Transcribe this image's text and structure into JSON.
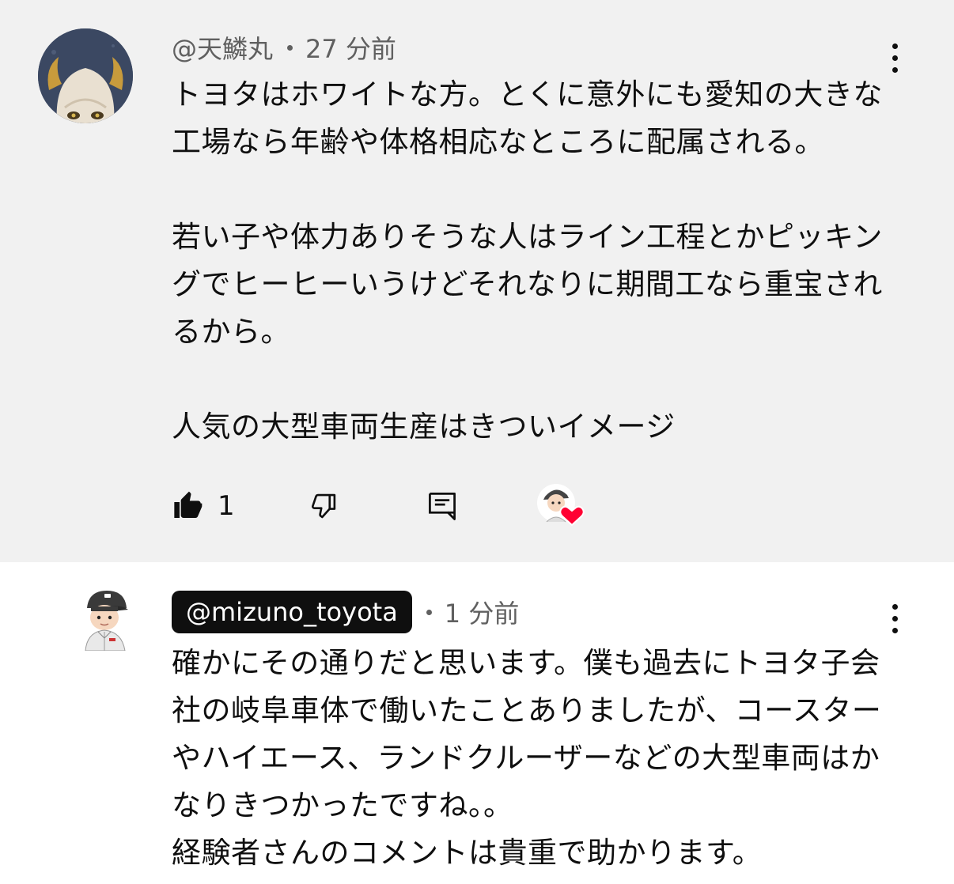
{
  "comments": [
    {
      "handle": "@天鱗丸",
      "time": "27 分前",
      "text": "トヨタはホワイトな方。とくに意外にも愛知の大きな工場なら年齢や体格相応なところに配属される。\n\n若い子や体力ありそうな人はライン工程とかピッキングでヒーヒーいうけどそれなりに期間工なら重宝されるから。\n\n人気の大型車両生産はきついイメージ",
      "like_count": "1",
      "avatar_icon": "oni-mask-avatar-icon",
      "creator_heart_icon": "creator-heart-icon"
    },
    {
      "handle": "@mizuno_toyota",
      "time": "1 分前",
      "text": "確かにその通りだと思います。僕も過去にトヨタ子会社の岐阜車体で働いたことありましたが、コースターやハイエース、ランドクルーザーなどの大型車両はかなりきつかったですね。。\n経験者さんのコメントは貴重で助かります。",
      "avatar_icon": "worker-cartoon-avatar-icon"
    }
  ],
  "colors": {
    "highlight_background": "#f1f1f1",
    "primary_text": "#0f0f0f",
    "secondary_text": "#606060",
    "heart": "#ff0033"
  }
}
